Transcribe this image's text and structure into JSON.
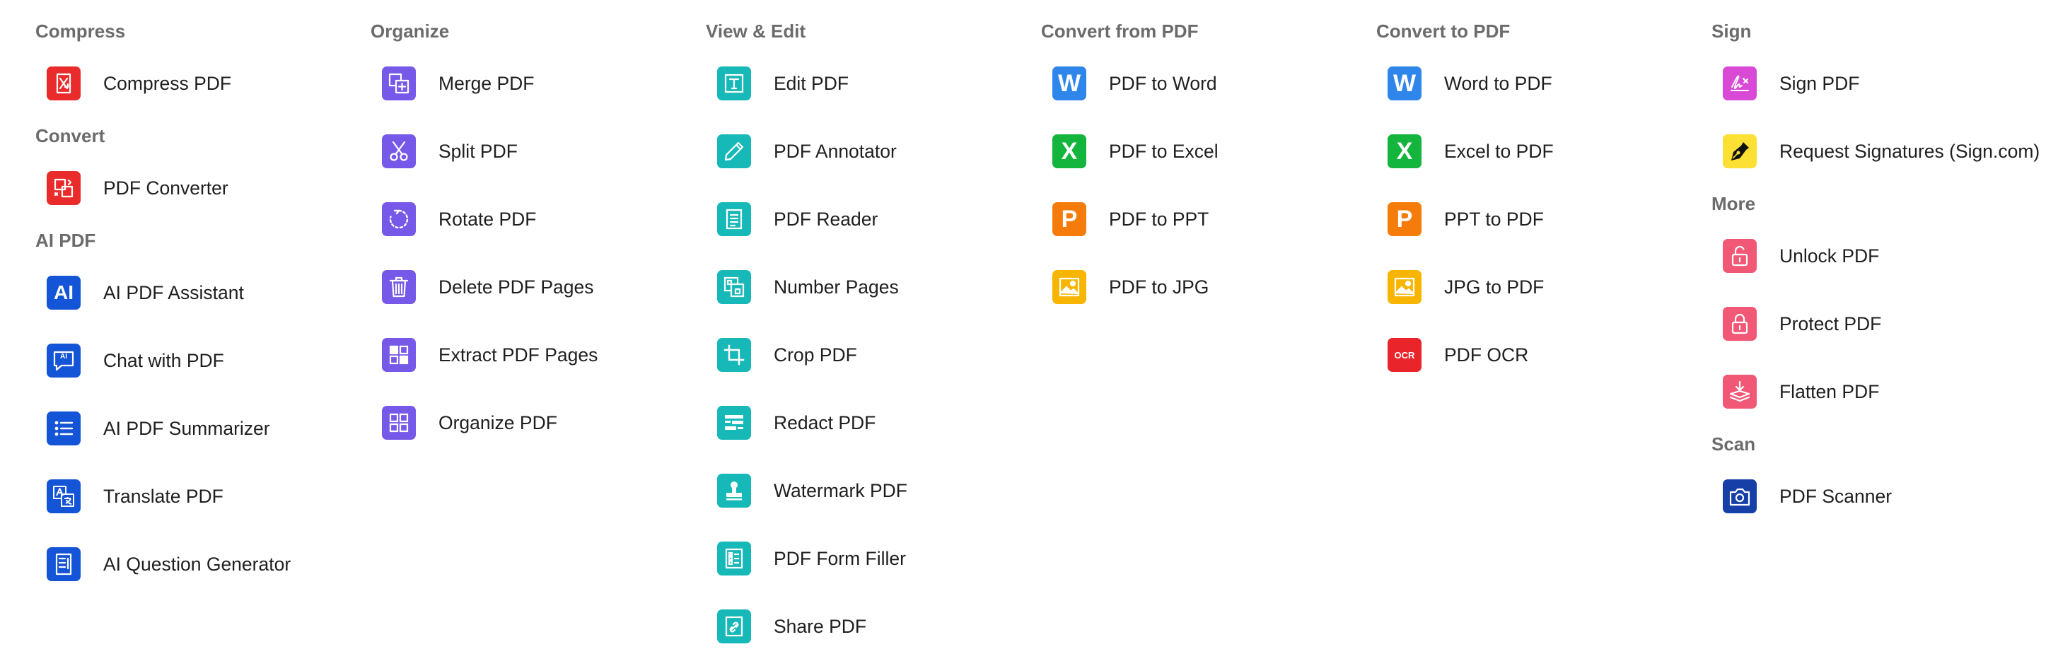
{
  "columns": [
    {
      "sections": [
        {
          "heading": "Compress",
          "items": [
            {
              "label": "Compress PDF",
              "icon": "compress-icon"
            }
          ]
        },
        {
          "heading": "Convert",
          "items": [
            {
              "label": "PDF Converter",
              "icon": "convert-icon"
            }
          ]
        },
        {
          "heading": "AI PDF",
          "items": [
            {
              "label": "AI PDF Assistant",
              "icon": "ai-icon"
            },
            {
              "label": "Chat with PDF",
              "icon": "chat-icon"
            },
            {
              "label": "AI PDF Summarizer",
              "icon": "list-icon"
            },
            {
              "label": "Translate PDF",
              "icon": "translate-icon"
            },
            {
              "label": "AI Question Generator",
              "icon": "question-doc-icon"
            }
          ]
        }
      ]
    },
    {
      "sections": [
        {
          "heading": "Organize",
          "items": [
            {
              "label": "Merge PDF",
              "icon": "merge-icon"
            },
            {
              "label": "Split PDF",
              "icon": "scissors-icon"
            },
            {
              "label": "Rotate PDF",
              "icon": "rotate-icon"
            },
            {
              "label": "Delete PDF Pages",
              "icon": "trash-icon"
            },
            {
              "label": "Extract PDF Pages",
              "icon": "extract-icon"
            },
            {
              "label": "Organize PDF",
              "icon": "grid-icon"
            }
          ]
        }
      ]
    },
    {
      "sections": [
        {
          "heading": "View & Edit",
          "items": [
            {
              "label": "Edit PDF",
              "icon": "edit-text-icon"
            },
            {
              "label": "PDF Annotator",
              "icon": "pencil-icon"
            },
            {
              "label": "PDF Reader",
              "icon": "document-icon"
            },
            {
              "label": "Number Pages",
              "icon": "number-pages-icon"
            },
            {
              "label": "Crop PDF",
              "icon": "crop-icon"
            },
            {
              "label": "Redact PDF",
              "icon": "redact-icon"
            },
            {
              "label": "Watermark PDF",
              "icon": "stamp-icon"
            },
            {
              "label": "PDF Form Filler",
              "icon": "form-icon"
            },
            {
              "label": "Share PDF",
              "icon": "share-link-icon"
            }
          ]
        }
      ]
    },
    {
      "sections": [
        {
          "heading": "Convert from PDF",
          "items": [
            {
              "label": "PDF to Word",
              "icon": "word-icon"
            },
            {
              "label": "PDF to Excel",
              "icon": "excel-icon"
            },
            {
              "label": "PDF to PPT",
              "icon": "ppt-icon"
            },
            {
              "label": "PDF to JPG",
              "icon": "image-icon"
            }
          ]
        }
      ]
    },
    {
      "sections": [
        {
          "heading": "Convert to PDF",
          "items": [
            {
              "label": "Word to PDF",
              "icon": "word-icon"
            },
            {
              "label": "Excel to PDF",
              "icon": "excel-icon"
            },
            {
              "label": "PPT to PDF",
              "icon": "ppt-icon"
            },
            {
              "label": "JPG to PDF",
              "icon": "image-icon"
            },
            {
              "label": "PDF OCR",
              "icon": "ocr-icon"
            }
          ]
        }
      ]
    },
    {
      "sections": [
        {
          "heading": "Sign",
          "items": [
            {
              "label": "Sign PDF",
              "icon": "signature-icon"
            },
            {
              "label": "Request Signatures (Sign.com)",
              "icon": "pen-nib-icon"
            }
          ]
        },
        {
          "heading": "More",
          "items": [
            {
              "label": "Unlock PDF",
              "icon": "unlock-icon"
            },
            {
              "label": "Protect PDF",
              "icon": "lock-icon"
            },
            {
              "label": "Flatten PDF",
              "icon": "flatten-icon"
            }
          ]
        },
        {
          "heading": "Scan",
          "items": [
            {
              "label": "PDF Scanner",
              "icon": "camera-icon"
            }
          ]
        }
      ]
    }
  ],
  "icon_text": {
    "ai": "AI",
    "chat": "AI",
    "word": "W",
    "excel": "X",
    "ppt": "P",
    "ocr": "OCR"
  },
  "colors": {
    "compress": "#ea2b2b",
    "ai_pdf": "#1454d6",
    "organize": "#7659e8",
    "view_edit": "#17b8b8",
    "word": "#2f86ea",
    "excel": "#14b53c",
    "ppt": "#f57c0a",
    "jpg": "#f7b500",
    "ocr": "#e9242b",
    "sign": "#d84ad6",
    "request_signatures": "#fde034",
    "more": "#f05876",
    "scan": "#1640a8",
    "heading_text": "#6b6b6b"
  }
}
